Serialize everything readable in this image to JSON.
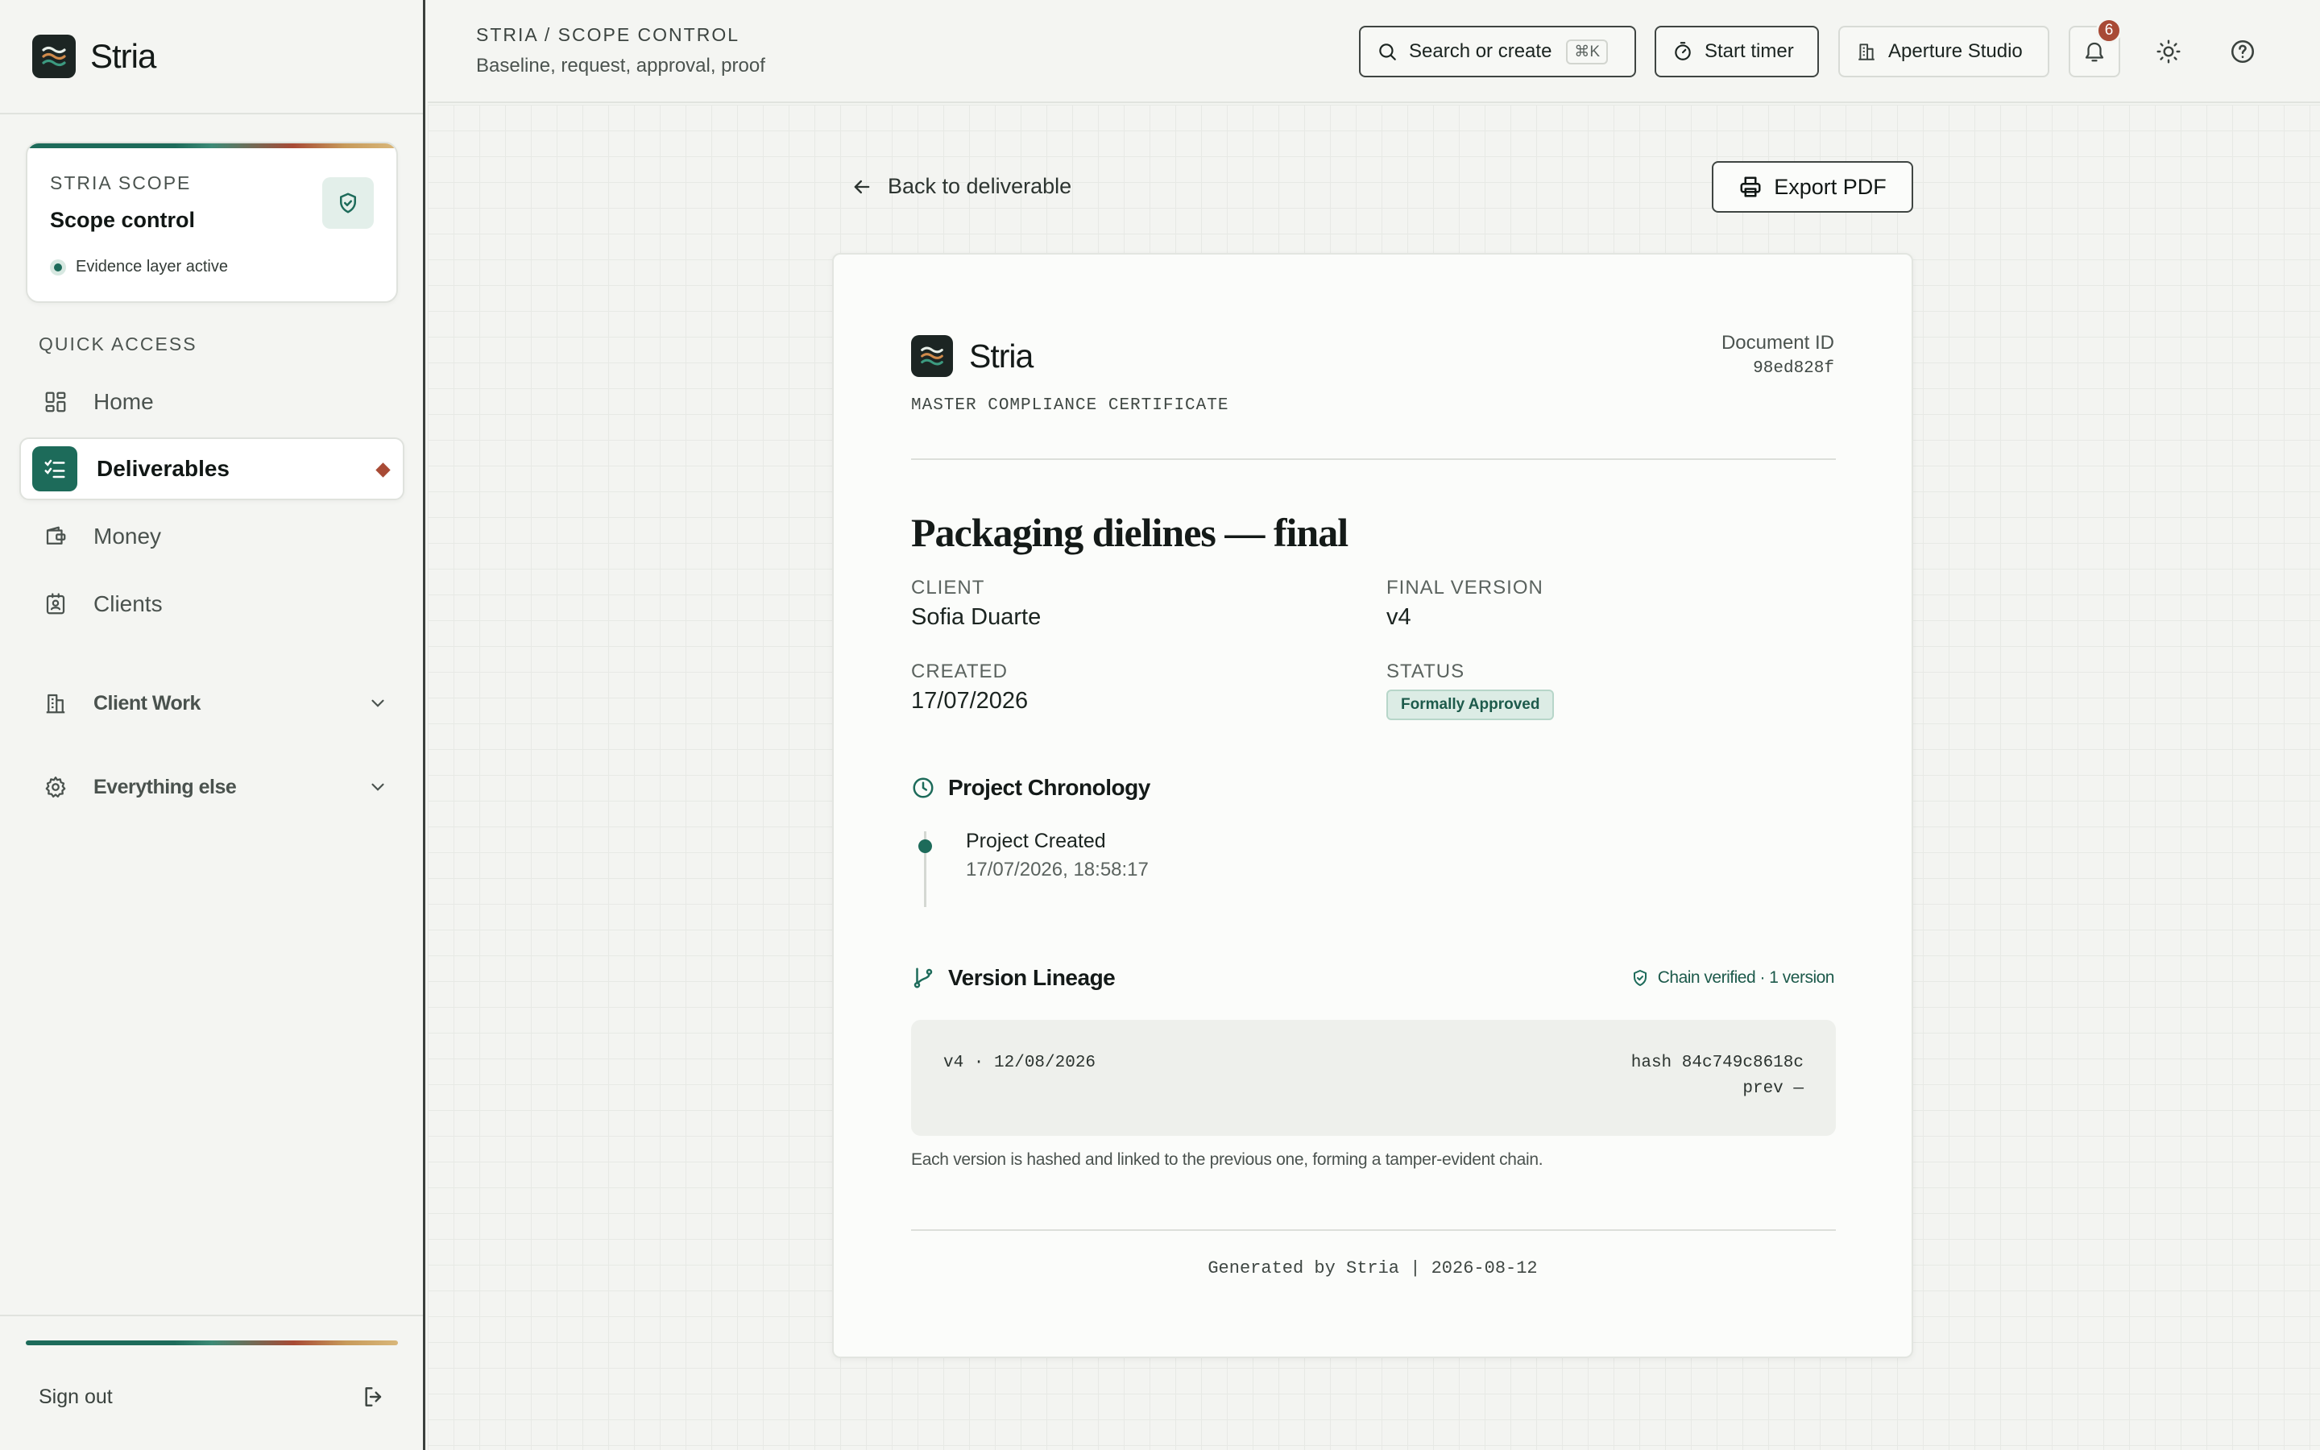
{
  "app": {
    "name": "Stria"
  },
  "sidebar": {
    "scope_card": {
      "eyebrow": "STRIA SCOPE",
      "title": "Scope control",
      "status": "Evidence layer active"
    },
    "section_label": "QUICK ACCESS",
    "items": [
      {
        "label": "Home",
        "icon": "grid-icon"
      },
      {
        "label": "Deliverables",
        "icon": "checklist-icon",
        "active": true
      },
      {
        "label": "Money",
        "icon": "wallet-icon"
      },
      {
        "label": "Clients",
        "icon": "contact-icon"
      }
    ],
    "groups": [
      {
        "label": "Client Work",
        "icon": "building-icon"
      },
      {
        "label": "Everything else",
        "icon": "gear-icon"
      }
    ],
    "signout": "Sign out"
  },
  "topbar": {
    "breadcrumb": "STRIA / SCOPE CONTROL",
    "subtitle": "Baseline, request, approval, proof",
    "search_label": "Search or create",
    "search_kbd": "⌘K",
    "timer_label": "Start timer",
    "workspace_label": "Aperture Studio",
    "notification_count": "6"
  },
  "page": {
    "back_label": "Back to deliverable",
    "export_label": "Export PDF"
  },
  "document": {
    "brand": "Stria",
    "kind": "MASTER COMPLIANCE CERTIFICATE",
    "id_label": "Document ID",
    "id_value": "98ed828f",
    "title": "Packaging dielines — final",
    "client_label": "CLIENT",
    "client_value": "Sofia Duarte",
    "final_version_label": "FINAL VERSION",
    "final_version_value": "v4",
    "created_label": "CREATED",
    "created_value": "17/07/2026",
    "status_label": "STATUS",
    "status_value": "Formally Approved",
    "chronology": {
      "heading": "Project Chronology",
      "events": [
        {
          "title": "Project Created",
          "time": "17/07/2026, 18:58:17"
        }
      ]
    },
    "lineage": {
      "heading": "Version Lineage",
      "verified": "Chain verified · 1 version",
      "versions": [
        {
          "label": "v4 · 12/08/2026",
          "hash": "hash 84c749c8618c",
          "prev": "prev —"
        }
      ],
      "note": "Each version is hashed and linked to the previous one, forming a tamper-evident chain."
    },
    "footer": "Generated by Stria | 2026-08-12"
  },
  "colors": {
    "accent": "#1d6b5a",
    "alert": "#a84a35",
    "ink": "#1c2523"
  }
}
